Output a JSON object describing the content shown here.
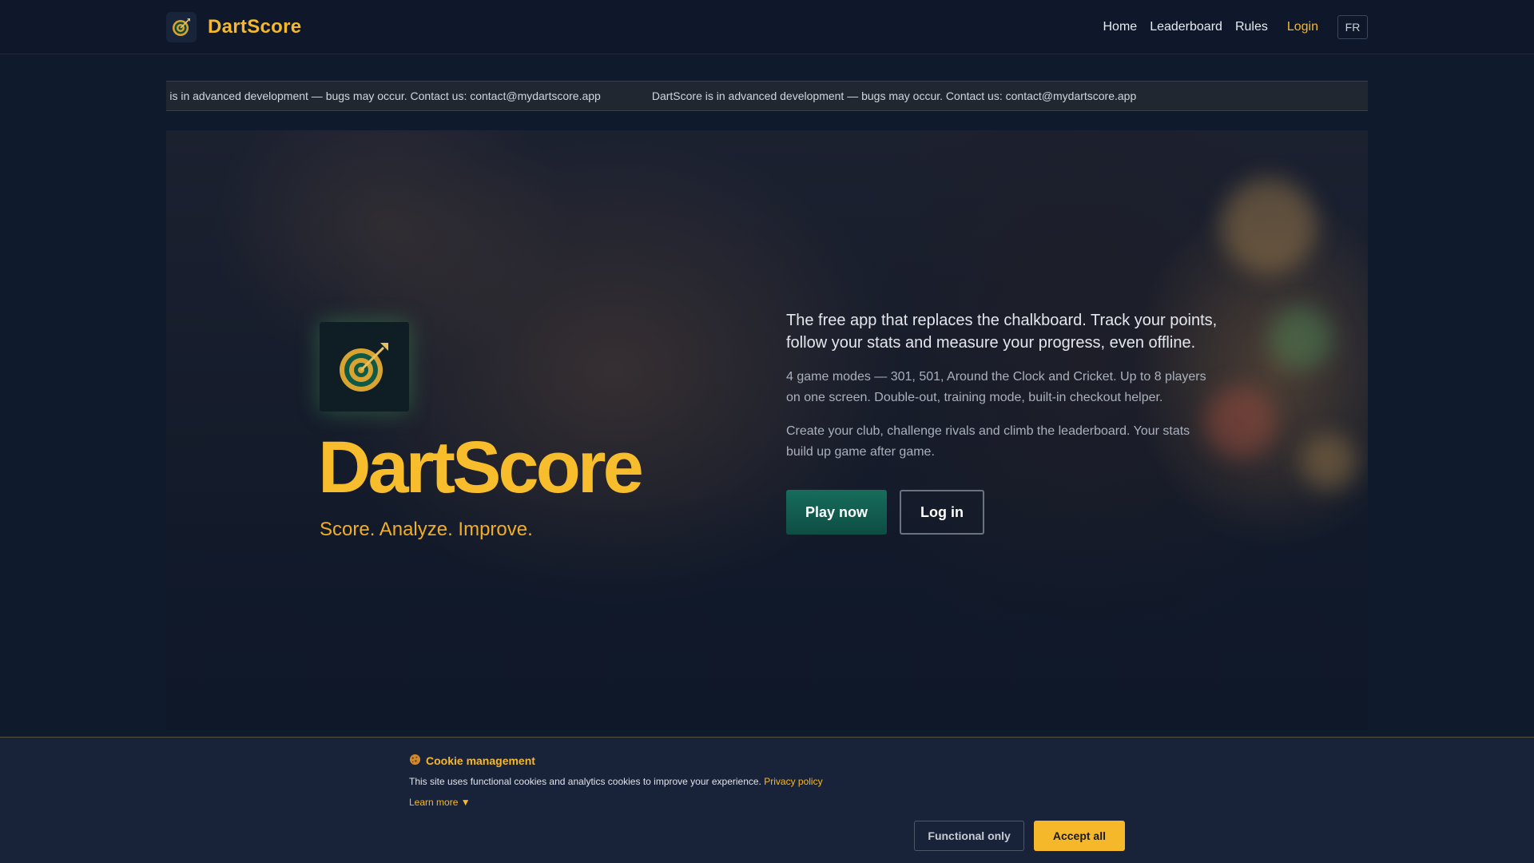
{
  "brand": {
    "name": "DartScore"
  },
  "nav": {
    "home": "Home",
    "leaderboard": "Leaderboard",
    "rules": "Rules",
    "login": "Login",
    "lang": "FR"
  },
  "ticker": {
    "message_partial": "tScore is in advanced development — bugs may occur. Contact us: contact@mydartscore.app",
    "message": "DartScore is in advanced development — bugs may occur. Contact us: contact@mydartscore.app"
  },
  "hero": {
    "title": "DartScore",
    "tagline": "Score. Analyze. Improve.",
    "lead": "The free app that replaces the chalkboard. Track your points, follow your stats and measure your progress, even offline.",
    "desc1": "4 game modes — 301, 501, Around the Clock and Cricket. Up to 8 players on one screen. Double-out, training mode, built-in checkout helper.",
    "desc2": "Create your club, challenge rivals and climb the leaderboard. Your stats build up game after game.",
    "play_label": "Play now",
    "login_label": "Log in"
  },
  "cookie": {
    "icon": "cookie-icon",
    "title": "Cookie management",
    "text": "This site uses functional cookies and analytics cookies to improve your experience.",
    "privacy_link": "Privacy policy",
    "learn_more": "Learn more ▼",
    "functional_label": "Functional only",
    "accept_label": "Accept all"
  },
  "colors": {
    "accent": "#f5b82a",
    "background": "#0f1a2c",
    "play_button": "#176d5c"
  }
}
